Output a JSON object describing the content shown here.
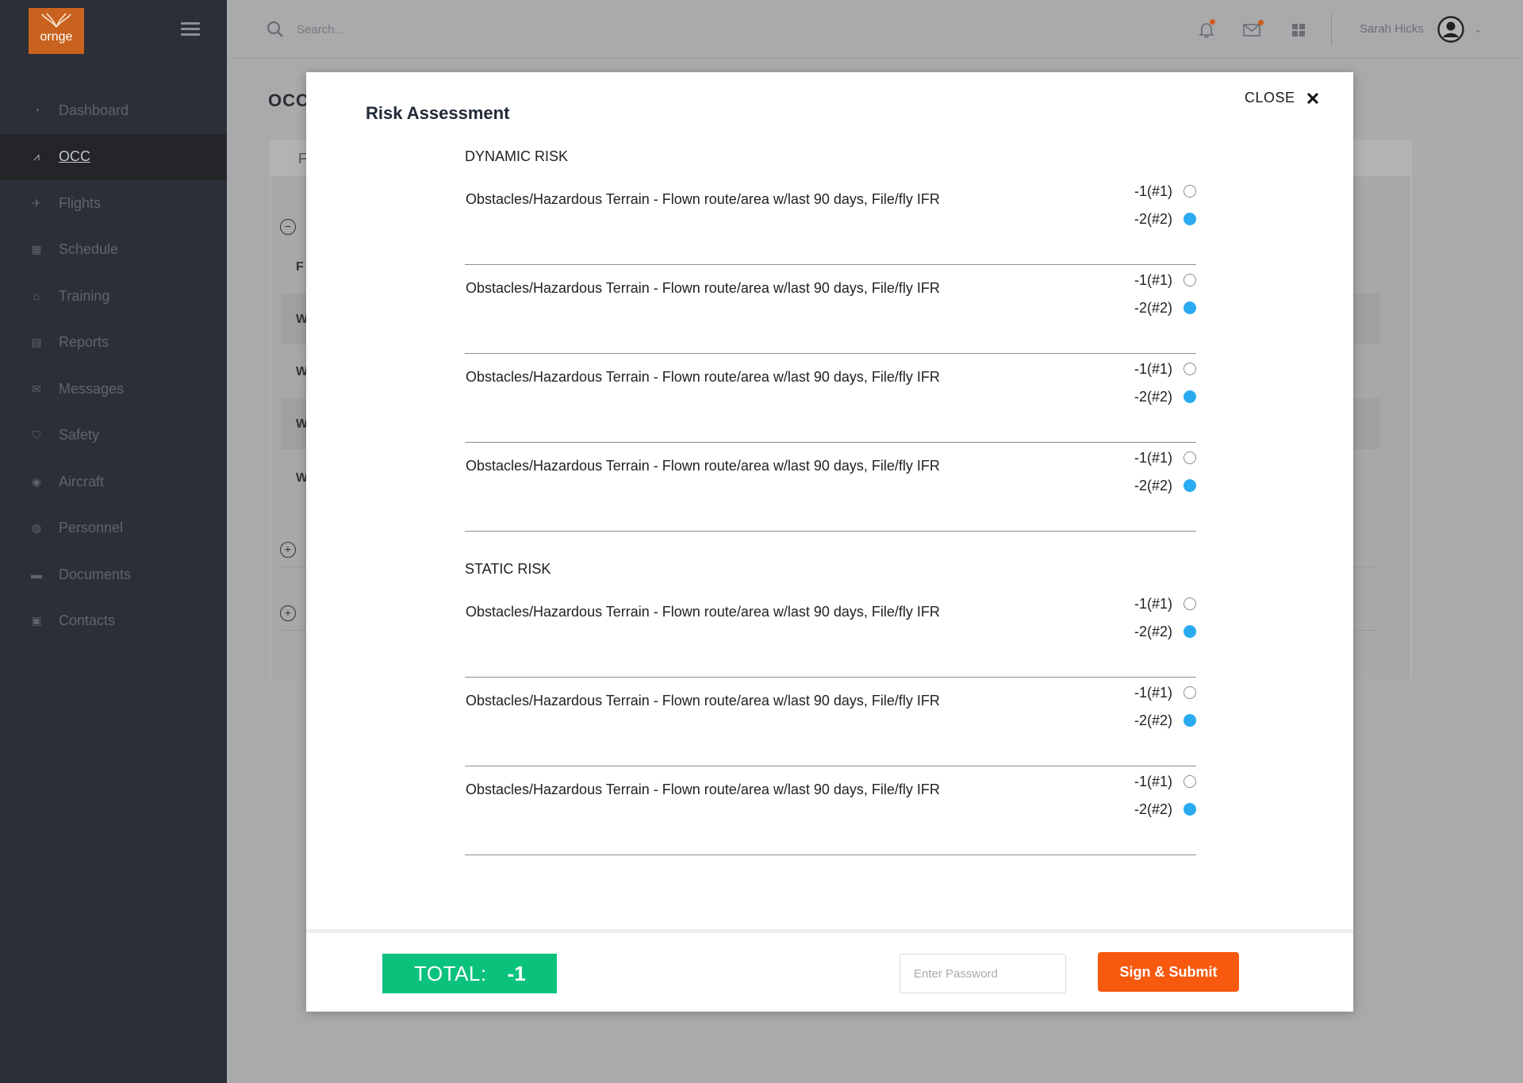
{
  "app": {
    "logo_text": "ornge"
  },
  "sidebar": {
    "items": [
      {
        "label": "Dashboard",
        "icon": "dashboard-icon",
        "active": false
      },
      {
        "label": "OCC",
        "icon": "chart-line-icon",
        "active": true
      },
      {
        "label": "Flights",
        "icon": "plane-icon",
        "active": false
      },
      {
        "label": "Schedule",
        "icon": "calendar-icon",
        "active": false
      },
      {
        "label": "Training",
        "icon": "graduation-cap-icon",
        "active": false
      },
      {
        "label": "Reports",
        "icon": "report-icon",
        "active": false
      },
      {
        "label": "Messages",
        "icon": "envelope-icon",
        "active": false
      },
      {
        "label": "Safety",
        "icon": "shield-icon",
        "active": false
      },
      {
        "label": "Aircraft",
        "icon": "aircraft-icon",
        "active": false
      },
      {
        "label": "Personnel",
        "icon": "person-icon",
        "active": false
      },
      {
        "label": "Documents",
        "icon": "folder-icon",
        "active": false
      },
      {
        "label": "Contacts",
        "icon": "contact-card-icon",
        "active": false
      }
    ]
  },
  "topbar": {
    "search_placeholder": "Search...",
    "user_name": "Sarah Hicks"
  },
  "background_page": {
    "title": "OCC",
    "tab_label": "F",
    "row_labels": [
      "F",
      "W",
      "W",
      "W",
      "W"
    ]
  },
  "modal": {
    "title": "Risk Assessment",
    "close_label": "CLOSE",
    "sections": [
      {
        "heading": "DYNAMIC RISK",
        "rows": [
          {
            "text": "Obstacles/Hazardous Terrain - Flown route/area w/last 90 days, File/fly IFR",
            "options": [
              "-1(#1)",
              "-2(#2)"
            ],
            "selected": 1
          },
          {
            "text": "Obstacles/Hazardous Terrain - Flown route/area w/last 90 days, File/fly IFR",
            "options": [
              "-1(#1)",
              "-2(#2)"
            ],
            "selected": 1
          },
          {
            "text": "Obstacles/Hazardous Terrain - Flown route/area w/last 90 days, File/fly IFR",
            "options": [
              "-1(#1)",
              "-2(#2)"
            ],
            "selected": 1
          },
          {
            "text": "Obstacles/Hazardous Terrain - Flown route/area w/last 90 days, File/fly IFR",
            "options": [
              "-1(#1)",
              "-2(#2)"
            ],
            "selected": 1
          }
        ]
      },
      {
        "heading": "STATIC RISK",
        "rows": [
          {
            "text": "Obstacles/Hazardous Terrain - Flown route/area w/last 90 days, File/fly IFR",
            "options": [
              "-1(#1)",
              "-2(#2)"
            ],
            "selected": 1
          },
          {
            "text": "Obstacles/Hazardous Terrain - Flown route/area w/last 90 days, File/fly IFR",
            "options": [
              "-1(#1)",
              "-2(#2)"
            ],
            "selected": 1
          },
          {
            "text": "Obstacles/Hazardous Terrain - Flown route/area w/last 90 days, File/fly IFR",
            "options": [
              "-1(#1)",
              "-2(#2)"
            ],
            "selected": 1
          }
        ]
      }
    ],
    "footer": {
      "total_label": "TOTAL:",
      "total_value": "-1",
      "password_placeholder": "Enter Password",
      "submit_label": "Sign & Submit"
    }
  },
  "colors": {
    "sidebar_bg": "#2c2f37",
    "brand_orange": "#c8621e",
    "radio_selected": "#2aaaf0",
    "total_green": "#0bc27c",
    "submit_orange": "#f7590f",
    "notification_dot": "#d05a1f"
  }
}
